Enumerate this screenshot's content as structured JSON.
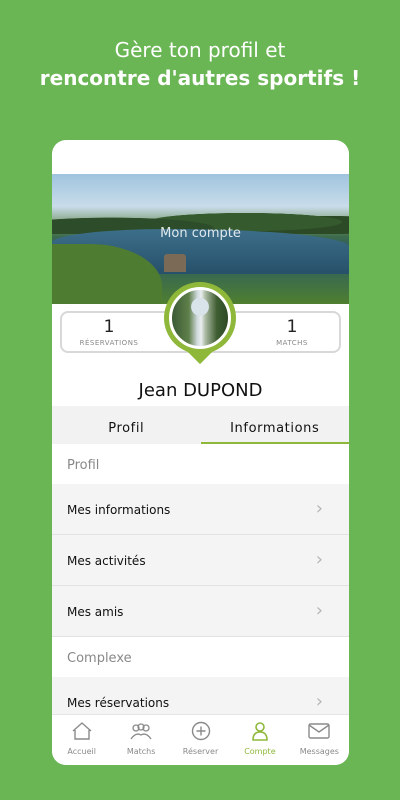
{
  "promo": {
    "line1": "Gère ton profil et",
    "line2": "rencontre d'autres sportifs !"
  },
  "header": {
    "title": "Mon compte"
  },
  "stats": {
    "reservations": {
      "value": "1",
      "label": "RÉSERVATIONS"
    },
    "matchs": {
      "value": "1",
      "label": "MATCHS"
    }
  },
  "user": {
    "name": "Jean DUPOND"
  },
  "tabs": [
    {
      "label": "Profil",
      "active": false
    },
    {
      "label": "Informations",
      "active": true
    }
  ],
  "sections": {
    "profil": {
      "header": "Profil",
      "items": [
        "Mes informations",
        "Mes activités",
        "Mes amis"
      ]
    },
    "complexe": {
      "header": "Complexe",
      "items": [
        "Mes réservations"
      ]
    }
  },
  "nav": [
    {
      "label": "Accueil",
      "icon": "home-icon",
      "active": false
    },
    {
      "label": "Matchs",
      "icon": "users-icon",
      "active": false
    },
    {
      "label": "Réserver",
      "icon": "plus-circle-icon",
      "active": false
    },
    {
      "label": "Compte",
      "icon": "user-icon",
      "active": true
    },
    {
      "label": "Messages",
      "icon": "mail-icon",
      "active": false
    }
  ],
  "colors": {
    "background": "#6ab655",
    "accent": "#8fb83a"
  }
}
